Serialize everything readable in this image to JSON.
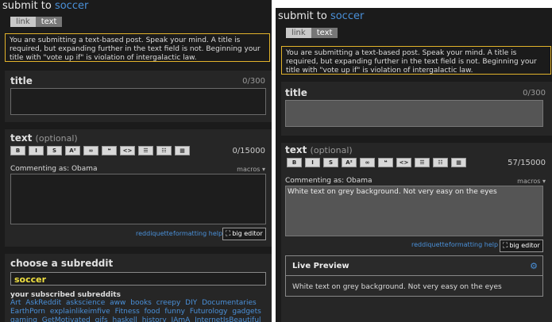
{
  "header": {
    "prefix": "submit to ",
    "subreddit": "soccer"
  },
  "tabs": {
    "link": "link",
    "text": "text"
  },
  "notice": "You are submitting a text-based post. Speak your mind. A title is required, but expanding further in the text field is not. Beginning your title with \"vote up if\" is violation of intergalactic law.",
  "title_section": {
    "label": "title",
    "counter": "0/300"
  },
  "text_section": {
    "label": "text",
    "optional": "(optional)",
    "toolbar": [
      "B",
      "I",
      "S",
      "A²",
      "∞",
      "❝",
      "<>",
      "☰",
      "☷",
      "▦"
    ],
    "commenting_as": "Commenting as: Obama",
    "macros": "macros ▾",
    "reddiquette": "reddiquette",
    "formatting_help": "formatting help",
    "big_editor": "big editor"
  },
  "left": {
    "text_counter": "0/15000",
    "body": ""
  },
  "right": {
    "text_counter": "57/15000",
    "body": "White text on grey background. Not very easy on the eyes"
  },
  "live_preview": {
    "title": "Live Preview",
    "body": "White text on grey background. Not very easy on the eyes"
  },
  "subreddit_section": {
    "label": "choose a subreddit",
    "value": "soccer",
    "subscribed_label": "your subscribed subreddits",
    "subscribed": "Art AskReddit askscience aww books creepy DIY Documentaries EarthPorn explainlikeimfive Fitness food funny Futurology gadgets gaming GetMotivated gifs haskell history IAmA InternetIsBeautiful"
  }
}
